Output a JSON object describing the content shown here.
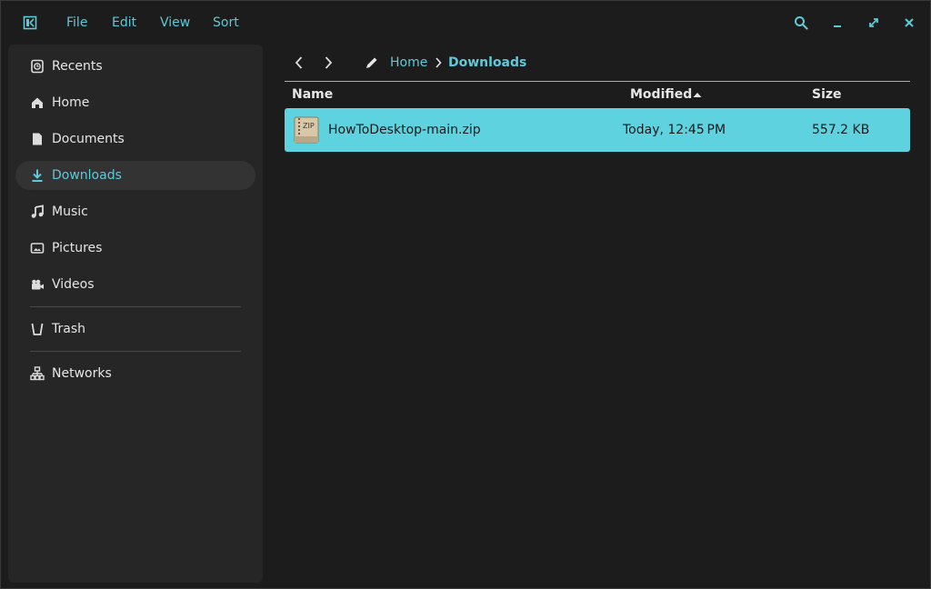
{
  "menu": {
    "file": "File",
    "edit": "Edit",
    "view": "View",
    "sort": "Sort"
  },
  "sidebar": {
    "items": [
      {
        "label": "Recents",
        "icon": "clock-icon"
      },
      {
        "label": "Home",
        "icon": "home-icon"
      },
      {
        "label": "Documents",
        "icon": "document-icon"
      },
      {
        "label": "Downloads",
        "icon": "download-icon",
        "active": true
      },
      {
        "label": "Music",
        "icon": "music-icon"
      },
      {
        "label": "Pictures",
        "icon": "picture-icon"
      },
      {
        "label": "Videos",
        "icon": "video-icon"
      },
      {
        "label": "Trash",
        "icon": "trash-icon"
      },
      {
        "label": "Networks",
        "icon": "network-icon"
      }
    ]
  },
  "breadcrumb": {
    "home": "Home",
    "current": "Downloads"
  },
  "table": {
    "headers": {
      "name": "Name",
      "modified": "Modified",
      "size": "Size"
    },
    "sort_column": "Modified",
    "sort_direction": "ascending",
    "rows": [
      {
        "name": "HowToDesktop-main.zip",
        "modified": "Today, 12:45 PM",
        "size": "557.2 KB",
        "icon": "zip-archive-icon",
        "selected": true
      }
    ]
  },
  "colors": {
    "accent": "#5ec9d9",
    "selection": "#5fd2e0",
    "background": "#1c1c1c",
    "sidebar": "#262626"
  }
}
